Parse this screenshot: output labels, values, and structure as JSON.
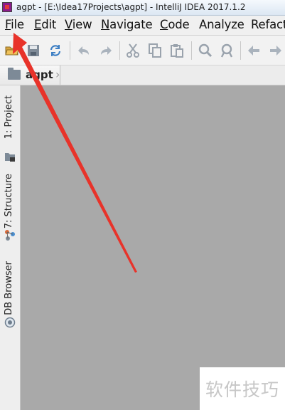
{
  "window": {
    "title": "agpt - [E:\\Idea17Projects\\agpt] - IntelliJ IDEA 2017.1.2"
  },
  "menu": {
    "items": [
      {
        "mnemonic": "F",
        "rest": "ile"
      },
      {
        "mnemonic": "E",
        "rest": "dit"
      },
      {
        "mnemonic": "V",
        "rest": "iew"
      },
      {
        "mnemonic": "N",
        "rest": "avigate"
      },
      {
        "mnemonic": "C",
        "rest": "ode"
      },
      {
        "mnemonic": "",
        "rest": "Analyze"
      },
      {
        "mnemonic": "",
        "rest": "Refact"
      }
    ]
  },
  "toolbar": {
    "icons": [
      "open-folder-icon",
      "save-icon",
      "sync-icon",
      "undo-icon",
      "redo-icon",
      "cut-icon",
      "copy-icon",
      "paste-icon",
      "find-icon",
      "replace-icon",
      "back-icon",
      "forward-icon"
    ]
  },
  "navbar": {
    "crumb": "agpt"
  },
  "tool_windows": {
    "project": "1: Project",
    "structure": "7: Structure",
    "db_browser": "DB Browser"
  },
  "watermark": {
    "text": "软件技巧"
  },
  "colors": {
    "arrow": "#e8332a",
    "editor_bg": "#a9a9a9"
  }
}
